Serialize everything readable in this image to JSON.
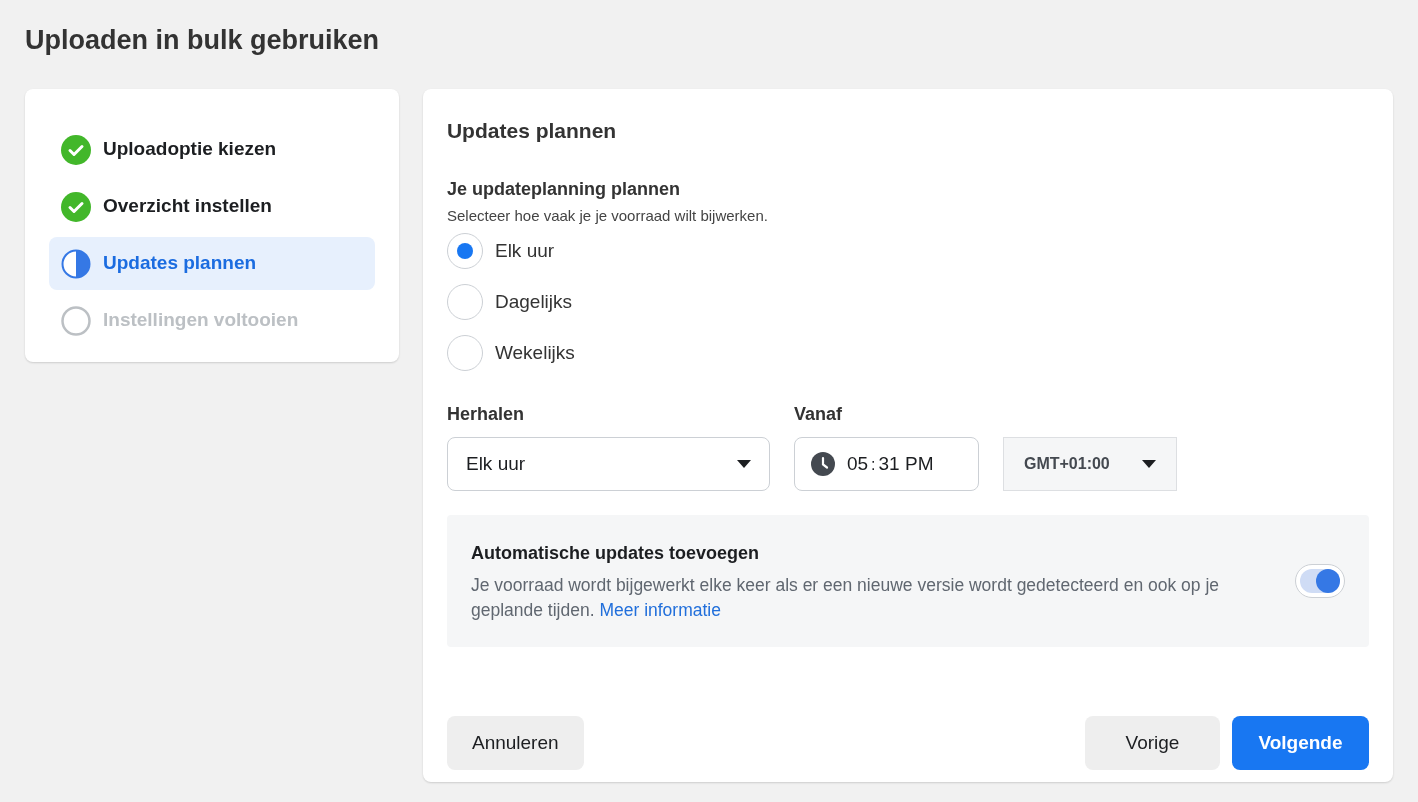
{
  "page_title": "Uploaden in bulk gebruiken",
  "steps": [
    {
      "label": "Uploadoptie kiezen",
      "kind": "done",
      "selected": false
    },
    {
      "label": "Overzicht instellen",
      "kind": "done",
      "selected": false
    },
    {
      "label": "Updates plannen",
      "kind": "current",
      "selected": true
    },
    {
      "label": "Instellingen voltooien",
      "kind": "todo",
      "selected": false
    }
  ],
  "panel": {
    "title": "Updates plannen",
    "schedule": {
      "heading": "Je updateplanning plannen",
      "subtitle": "Selecteer hoe vaak je je voorraad wilt bijwerken.",
      "options": [
        {
          "label": "Elk uur",
          "selected": true
        },
        {
          "label": "Dagelijks",
          "selected": false
        },
        {
          "label": "Wekelijks",
          "selected": false
        }
      ]
    },
    "repeat": {
      "label": "Herhalen",
      "value": "Elk uur"
    },
    "from": {
      "label": "Vanaf",
      "hour": "05",
      "separator": ":",
      "minute": "31",
      "period": "PM"
    },
    "timezone": {
      "value": "GMT+01:00"
    },
    "auto_updates": {
      "title": "Automatische updates toevoegen",
      "description": "Je voorraad wordt bijgewerkt elke keer als er een nieuwe versie wordt gedetecteerd en ook op je geplande tijden.",
      "link": "Meer informatie",
      "on": true
    },
    "buttons": {
      "cancel": "Annuleren",
      "previous": "Vorige",
      "next": "Volgende"
    }
  }
}
